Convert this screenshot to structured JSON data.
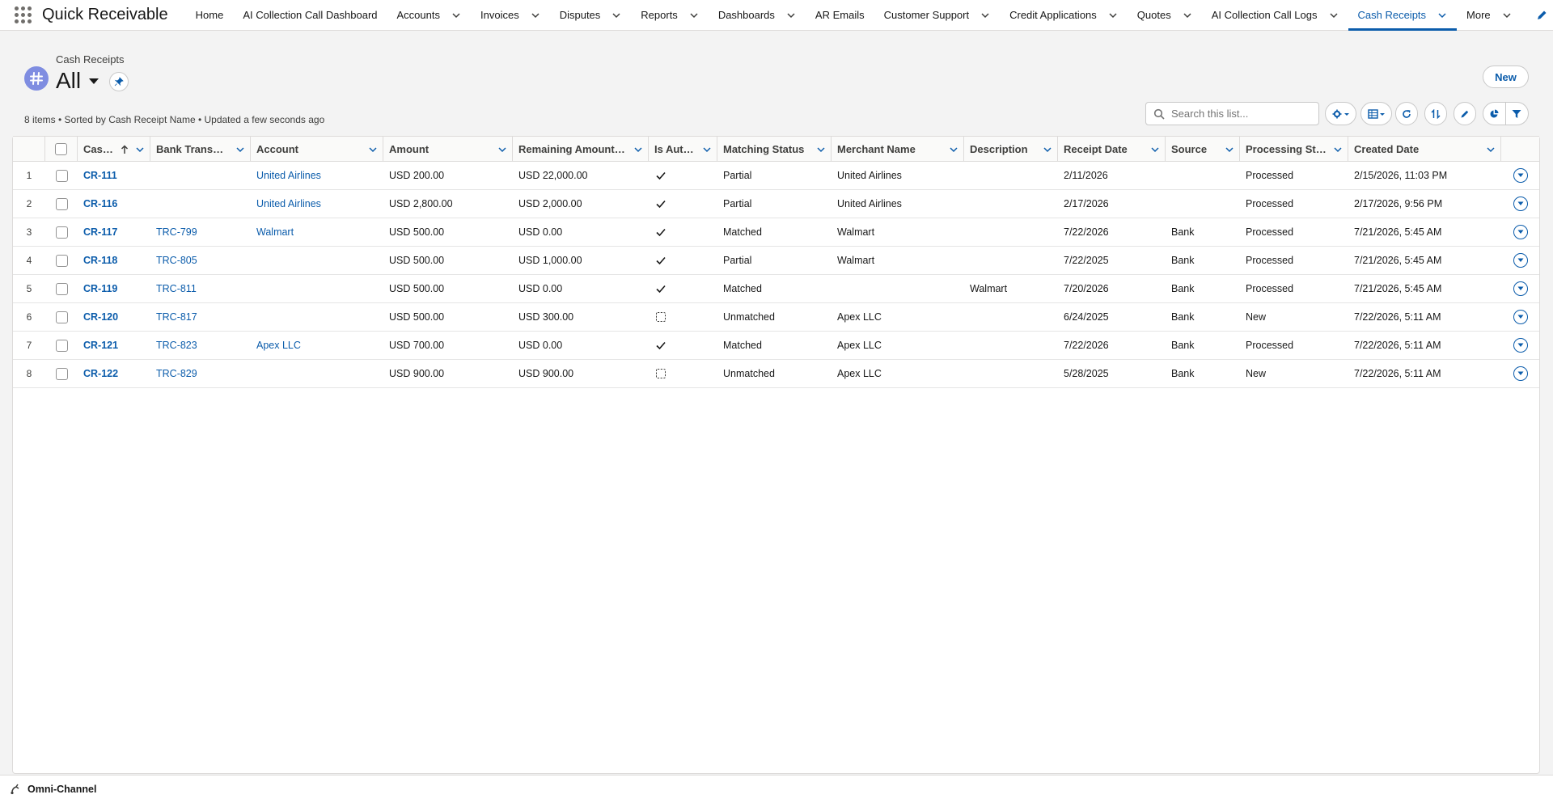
{
  "app": {
    "name": "Quick Receivable"
  },
  "nav": {
    "items": [
      {
        "label": "Home",
        "chevron": false
      },
      {
        "label": "AI Collection Call Dashboard",
        "chevron": false
      },
      {
        "label": "Accounts",
        "chevron": true
      },
      {
        "label": "Invoices",
        "chevron": true
      },
      {
        "label": "Disputes",
        "chevron": true
      },
      {
        "label": "Reports",
        "chevron": true
      },
      {
        "label": "Dashboards",
        "chevron": true
      },
      {
        "label": "AR Emails",
        "chevron": false
      },
      {
        "label": "Customer Support",
        "chevron": true
      },
      {
        "label": "Credit Applications",
        "chevron": true
      },
      {
        "label": "Quotes",
        "chevron": true
      },
      {
        "label": "AI Collection Call Logs",
        "chevron": true
      },
      {
        "label": "Cash Receipts",
        "chevron": true,
        "active": true
      },
      {
        "label": "More",
        "chevron": true
      }
    ]
  },
  "header": {
    "object_label": "Cash Receipts",
    "list_view": "All",
    "new_button": "New",
    "meta": "8 items • Sorted by Cash Receipt Name • Updated a few seconds ago",
    "search_placeholder": "Search this list..."
  },
  "table": {
    "columns": [
      {
        "label": "Cash ...",
        "sorted": "asc"
      },
      {
        "label": "Bank Transacti..."
      },
      {
        "label": "Account"
      },
      {
        "label": "Amount"
      },
      {
        "label": "Remaining Amount T..."
      },
      {
        "label": "Is Auto..."
      },
      {
        "label": "Matching Status"
      },
      {
        "label": "Merchant Name"
      },
      {
        "label": "Description"
      },
      {
        "label": "Receipt Date"
      },
      {
        "label": "Source"
      },
      {
        "label": "Processing Stat..."
      },
      {
        "label": "Created Date"
      }
    ],
    "rows": [
      {
        "num": "1",
        "name": "CR-111",
        "bank_txn": "",
        "account": "United Airlines",
        "amount": "USD 200.00",
        "remaining": "USD 22,000.00",
        "is_auto": true,
        "matching": "Partial",
        "merchant": "United Airlines",
        "description": "",
        "receipt_date": "2/11/2026",
        "source": "",
        "processing": "Processed",
        "created": "2/15/2026, 11:03 PM"
      },
      {
        "num": "2",
        "name": "CR-116",
        "bank_txn": "",
        "account": "United Airlines",
        "amount": "USD 2,800.00",
        "remaining": "USD 2,000.00",
        "is_auto": true,
        "matching": "Partial",
        "merchant": "United Airlines",
        "description": "",
        "receipt_date": "2/17/2026",
        "source": "",
        "processing": "Processed",
        "created": "2/17/2026, 9:56 PM"
      },
      {
        "num": "3",
        "name": "CR-117",
        "bank_txn": "TRC-799",
        "account": "Walmart",
        "amount": "USD 500.00",
        "remaining": "USD 0.00",
        "is_auto": true,
        "matching": "Matched",
        "merchant": "Walmart",
        "description": "",
        "receipt_date": "7/22/2026",
        "source": "Bank",
        "processing": "Processed",
        "created": "7/21/2026, 5:45 AM"
      },
      {
        "num": "4",
        "name": "CR-118",
        "bank_txn": "TRC-805",
        "account": "",
        "amount": "USD 500.00",
        "remaining": "USD 1,000.00",
        "is_auto": true,
        "matching": "Partial",
        "merchant": "Walmart",
        "description": "",
        "receipt_date": "7/22/2025",
        "source": "Bank",
        "processing": "Processed",
        "created": "7/21/2026, 5:45 AM"
      },
      {
        "num": "5",
        "name": "CR-119",
        "bank_txn": "TRC-811",
        "account": "",
        "amount": "USD 500.00",
        "remaining": "USD 0.00",
        "is_auto": true,
        "matching": "Matched",
        "merchant": "",
        "description": "Walmart",
        "receipt_date": "7/20/2026",
        "source": "Bank",
        "processing": "Processed",
        "created": "7/21/2026, 5:45 AM"
      },
      {
        "num": "6",
        "name": "CR-120",
        "bank_txn": "TRC-817",
        "account": "",
        "amount": "USD 500.00",
        "remaining": "USD 300.00",
        "is_auto": false,
        "matching": "Unmatched",
        "merchant": "Apex LLC",
        "description": "",
        "receipt_date": "6/24/2025",
        "source": "Bank",
        "processing": "New",
        "created": "7/22/2026, 5:11 AM"
      },
      {
        "num": "7",
        "name": "CR-121",
        "bank_txn": "TRC-823",
        "account": "Apex LLC",
        "amount": "USD 700.00",
        "remaining": "USD 0.00",
        "is_auto": true,
        "matching": "Matched",
        "merchant": "Apex LLC",
        "description": "",
        "receipt_date": "7/22/2026",
        "source": "Bank",
        "processing": "Processed",
        "created": "7/22/2026, 5:11 AM"
      },
      {
        "num": "8",
        "name": "CR-122",
        "bank_txn": "TRC-829",
        "account": "",
        "amount": "USD 900.00",
        "remaining": "USD 900.00",
        "is_auto": false,
        "matching": "Unmatched",
        "merchant": "Apex LLC",
        "description": "",
        "receipt_date": "5/28/2025",
        "source": "Bank",
        "processing": "New",
        "created": "7/22/2026, 5:11 AM"
      }
    ]
  },
  "footer": {
    "label": "Omni-Channel"
  },
  "colors": {
    "brand": "#0b5cab",
    "object_icon": "#7f8de1",
    "border": "#dddbda"
  }
}
